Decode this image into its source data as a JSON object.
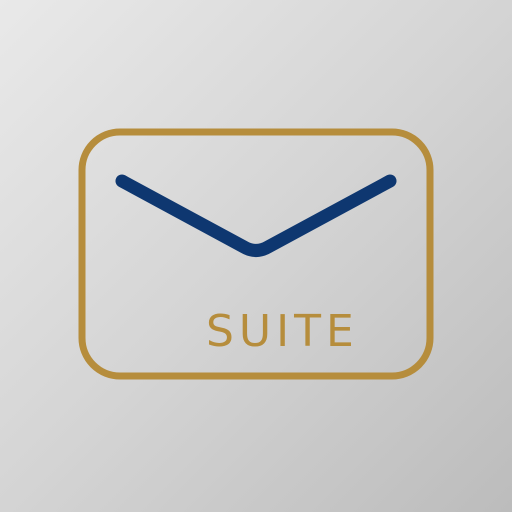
{
  "app_icon": {
    "label": "SUITE",
    "icon": "envelope-icon",
    "colors": {
      "frame": "#b68d3c",
      "flap": "#0e3770",
      "label": "#b68d3c",
      "background_light": "#e9e9e9",
      "background_dark": "#bcbcbc"
    }
  }
}
